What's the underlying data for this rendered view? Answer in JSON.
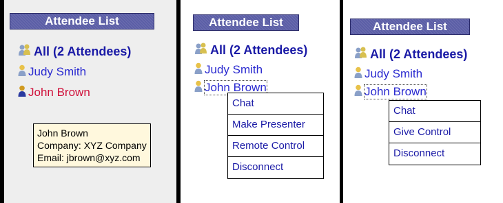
{
  "panel1": {
    "title": "Attendee List",
    "all_label": "All (2 Attendees)",
    "attendees": [
      "Judy Smith",
      "John Brown"
    ],
    "tooltip": [
      "John Brown",
      "Company: XYZ Company",
      "Email: jbrown@xyz.com"
    ]
  },
  "panel2": {
    "title": "Attendee List",
    "all_label": "All (2 Attendees)",
    "attendees": [
      "Judy Smith",
      "John Brown"
    ],
    "menu": [
      "Chat",
      "Make Presenter",
      "Remote Control",
      "Disconnect"
    ]
  },
  "panel3": {
    "title": "Attendee List",
    "all_label": "All (2 Attendees)",
    "attendees": [
      "Judy Smith",
      "John Brown"
    ],
    "menu": [
      "Chat",
      "Give Control",
      "Disconnect"
    ]
  },
  "colors": {
    "title_bar": "#5b5ea6",
    "link_blue": "#1a1aa6",
    "selected_red": "#d0103a",
    "tooltip_bg": "#fff8dd"
  },
  "icons": {
    "group": "group-icon",
    "person": "person-icon"
  }
}
